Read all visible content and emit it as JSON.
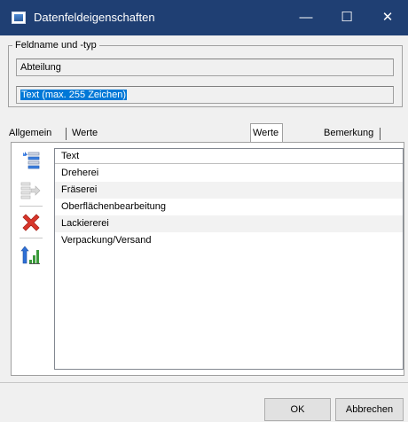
{
  "window": {
    "title": "Datenfeldeigenschaften",
    "minimize": "—",
    "maximize": "☐",
    "close": "✕"
  },
  "group": {
    "legend": "Feldname und -typ",
    "name_value": "Abteilung",
    "type_value": "Text  (max. 255 Zeichen)"
  },
  "tabs": [
    {
      "label": "Allgemein"
    },
    {
      "label": "Werte (Standard, Minimum, Maximum)"
    },
    {
      "label": "Werte (Liste)"
    },
    {
      "label": "Bemerkung"
    }
  ],
  "toolbar_icons": [
    "insert-row-icon",
    "move-right-icon",
    "delete-icon",
    "sort-ascending-icon"
  ],
  "list": {
    "header": "Text",
    "items": [
      "Dreherei",
      "Fräserei",
      "Oberflächenbearbeitung",
      "Lackiererei",
      "Verpackung/Versand"
    ]
  },
  "buttons": {
    "ok": "OK",
    "cancel": "Abbrechen"
  },
  "colors": {
    "titlebar": "#1f3f73",
    "selection": "#0078d7",
    "delete": "#d9362b"
  }
}
